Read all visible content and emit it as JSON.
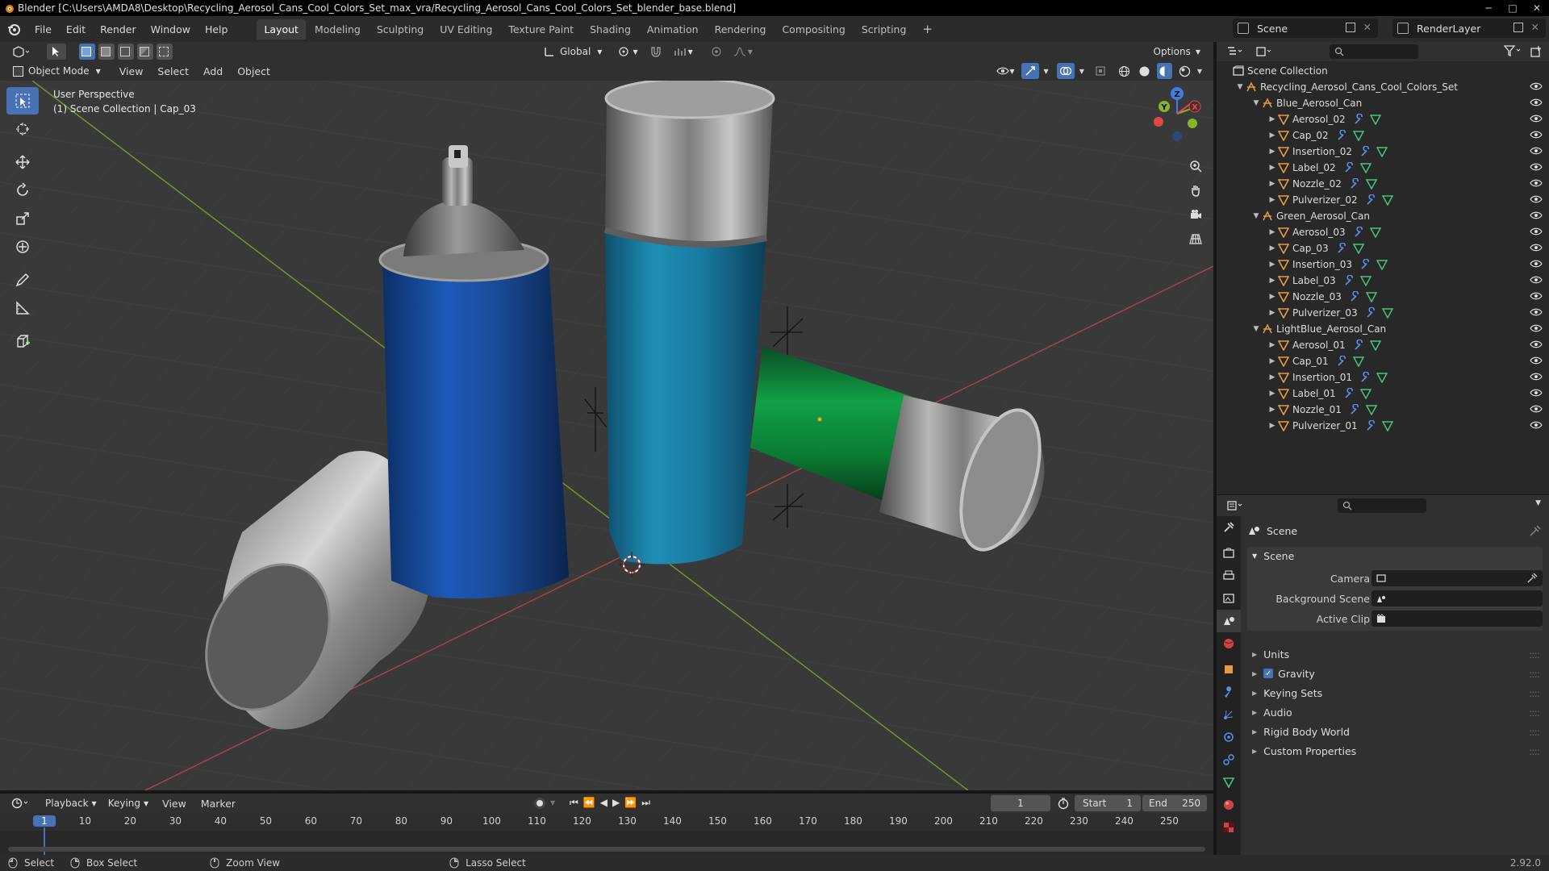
{
  "window": {
    "title": "Blender [C:\\Users\\AMDA8\\Desktop\\Recycling_Aerosol_Cans_Cool_Colors_Set_max_vra/Recycling_Aerosol_Cans_Cool_Colors_Set_blender_base.blend]",
    "controls": [
      "minimize",
      "maximize",
      "close"
    ]
  },
  "menu": [
    "File",
    "Edit",
    "Render",
    "Window",
    "Help"
  ],
  "workspaces": [
    "Layout",
    "Modeling",
    "Sculpting",
    "UV Editing",
    "Texture Paint",
    "Shading",
    "Animation",
    "Rendering",
    "Compositing",
    "Scripting"
  ],
  "active_workspace": "Layout",
  "add_workspace": "+",
  "scene_selector": "Scene",
  "layer_selector": "RenderLayer",
  "viewport_header": {
    "transform_orientation": "Global",
    "options": "Options",
    "mode": "Object Mode",
    "menus": [
      "View",
      "Select",
      "Add",
      "Object"
    ]
  },
  "viewport": {
    "perspective": "User Perspective",
    "collection_info": "(1) Scene Collection | Cap_03",
    "gizmo_axes": [
      "X",
      "Y",
      "Z"
    ]
  },
  "outliner": {
    "root": "Scene Collection",
    "set": "Recycling_Aerosol_Cans_Cool_Colors_Set",
    "groups": [
      {
        "name": "Blue_Aerosol_Can",
        "children": [
          "Aerosol_02",
          "Cap_02",
          "Insertion_02",
          "Label_02",
          "Nozzle_02",
          "Pulverizer_02"
        ]
      },
      {
        "name": "Green_Aerosol_Can",
        "children": [
          "Aerosol_03",
          "Cap_03",
          "Insertion_03",
          "Label_03",
          "Nozzle_03",
          "Pulverizer_03"
        ]
      },
      {
        "name": "LightBlue_Aerosol_Can",
        "children": [
          "Aerosol_01",
          "Cap_01",
          "Insertion_01",
          "Label_01",
          "Nozzle_01",
          "Pulverizer_01"
        ]
      }
    ]
  },
  "properties": {
    "context": "Scene",
    "section": "Scene",
    "fields": [
      {
        "label": "Camera",
        "value": ""
      },
      {
        "label": "Background Scene",
        "value": ""
      },
      {
        "label": "Active Clip",
        "value": ""
      }
    ],
    "panels": [
      "Units",
      "Gravity",
      "Keying Sets",
      "Audio",
      "Rigid Body World",
      "Custom Properties"
    ],
    "gravity_checked": true
  },
  "timeline": {
    "menus": [
      "Playback",
      "Keying",
      "View",
      "Marker"
    ],
    "current_frame": "1",
    "start_label": "Start",
    "start": "1",
    "end_label": "End",
    "end": "250",
    "ruler": [
      "1",
      "10",
      "20",
      "30",
      "40",
      "50",
      "60",
      "70",
      "80",
      "90",
      "100",
      "110",
      "120",
      "130",
      "140",
      "150",
      "160",
      "170",
      "180",
      "190",
      "200",
      "210",
      "220",
      "230",
      "240",
      "250"
    ]
  },
  "statusbar": {
    "items": [
      "Select",
      "Box Select",
      "Zoom View",
      "Lasso Select"
    ],
    "version": "2.92.0"
  },
  "colors": {
    "accent": "#4772b3",
    "x_axis": "#e0474a",
    "y_axis": "#84b52a",
    "z_axis": "#3f7ee0",
    "object_icon": "#e59a42"
  }
}
